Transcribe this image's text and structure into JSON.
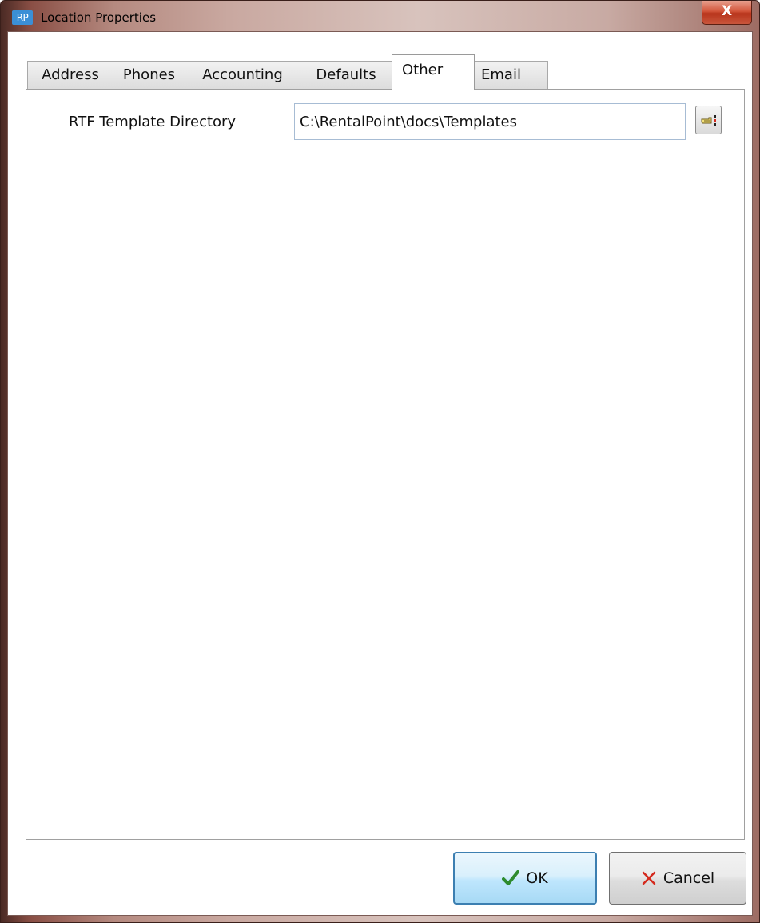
{
  "window": {
    "title": "Location Properties",
    "app_icon_text": "RP",
    "close_glyph": "X"
  },
  "tabs": [
    {
      "label": "Address",
      "active": false
    },
    {
      "label": "Phones",
      "active": false
    },
    {
      "label": "Accounting",
      "active": false
    },
    {
      "label": "Defaults",
      "active": false
    },
    {
      "label": "Other",
      "active": true
    },
    {
      "label": "Email",
      "active": false
    }
  ],
  "other_tab": {
    "rtf_label": "RTF Template Directory",
    "rtf_value": "C:\\RentalPoint\\docs\\Templates",
    "browse_icon": "pointing-hand-icon"
  },
  "buttons": {
    "ok_label": "OK",
    "cancel_label": "Cancel",
    "ok_icon": "check-icon",
    "cancel_icon": "x-icon"
  },
  "colors": {
    "ok_check": "#2e8b2e",
    "cancel_x": "#d42a1e",
    "accent_border": "#3c7fb1"
  }
}
